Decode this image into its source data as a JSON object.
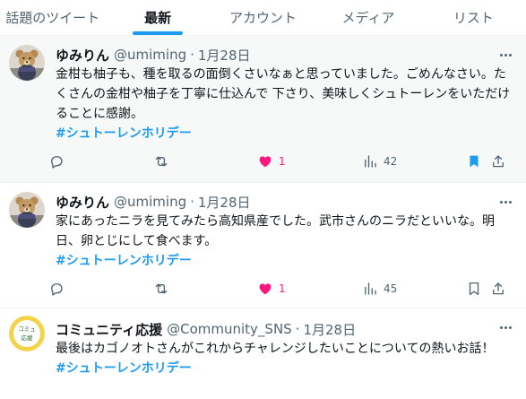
{
  "tabs": [
    {
      "label": "話題のツイート"
    },
    {
      "label": "最新"
    },
    {
      "label": "アカウント"
    },
    {
      "label": "メディア"
    },
    {
      "label": "リスト"
    }
  ],
  "active_tab": "最新",
  "tweets": [
    {
      "name": "ゆみりん",
      "handle": "@umiming",
      "dot": "·",
      "time": "1月28日",
      "text": "金柑も柚子も、種を取るの面倒くさいなぁと思っていました。ごめんなさい。たくさんの金柑や柚子を丁寧に仕込んで 下さり、美味しくシュトーレンをいただけることに感謝。",
      "hashtag": "#シュトーレンホリデー",
      "likes": "1",
      "views": "42",
      "liked": true,
      "bookmarked": true,
      "avatar_icon": "teddy-bear-icon"
    },
    {
      "name": "ゆみりん",
      "handle": "@umiming",
      "dot": "·",
      "time": "1月28日",
      "text": "家にあったニラを見てみたら高知県産でした。武市さんのニラだといいな。明日、卵とじにして食べます。",
      "hashtag": "#シュトーレンホリデー",
      "likes": "1",
      "views": "45",
      "liked": true,
      "bookmarked": false,
      "avatar_icon": "teddy-bear-icon"
    },
    {
      "name": "コミュニティ応援",
      "handle": "@Community_SNS",
      "dot": "·",
      "time": "1月28日",
      "text": "最後はカゴノオトさんがこれからチャレンジしたいことについての熱いお話！",
      "hashtag": " #シュトーレンホリデー",
      "avatar_icon": "community-logo-icon",
      "avatar_text": "コミュニティ応援"
    }
  ],
  "colors": {
    "accent": "#1d9bf0",
    "like": "#f91880",
    "text": "#0f1419",
    "muted": "#536471",
    "highlight_bg": "#f7f9f9"
  }
}
